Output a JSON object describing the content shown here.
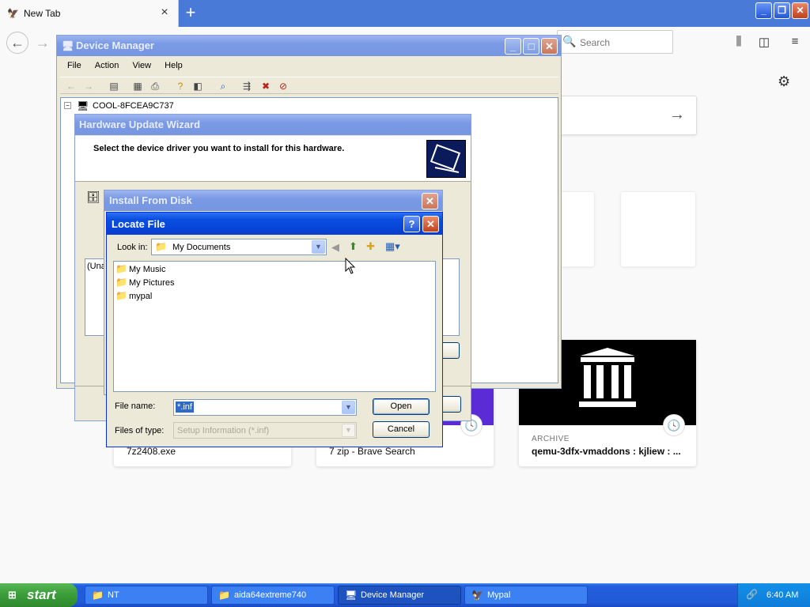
{
  "browser": {
    "tab_title": "New Tab",
    "tab_close": "×",
    "new_tab": "+",
    "search_placeholder": "Search",
    "icons": [
      "back-arrow-icon",
      "forward-arrow-icon",
      "library-icon",
      "sidebar-icon",
      "hamburger-menu-icon",
      "gear-icon",
      "search-icon"
    ],
    "cards": [
      {
        "title": "7z2408.exe"
      },
      {
        "title": "7 zip - Brave Search"
      },
      {
        "tag": "ARCHIVE",
        "title": "qemu-3dfx-vmaddons : kjliew : ..."
      }
    ]
  },
  "device_manager": {
    "title": "Device Manager",
    "menu": [
      "File",
      "Action",
      "View",
      "Help"
    ],
    "tree_root": "COOL-8FCEA9C737"
  },
  "wizard": {
    "title": "Hardware Update Wizard",
    "heading": "Select the device driver you want to install for this hardware.",
    "left_fragment": "(Una"
  },
  "install_from_disk": {
    "title": "Install From Disk"
  },
  "locate_file": {
    "title": "Locate File",
    "look_in_label": "Look in:",
    "look_in_value": "My Documents",
    "items": [
      {
        "name": "My Music",
        "icon": "music-folder-icon"
      },
      {
        "name": "My Pictures",
        "icon": "pictures-folder-icon"
      },
      {
        "name": "mypal",
        "icon": "folder-icon"
      }
    ],
    "file_name_label": "File name:",
    "file_name_value": "*.inf",
    "files_of_type_label": "Files of type:",
    "files_of_type_value": "Setup Information (*.inf)",
    "open_button": "Open",
    "cancel_button": "Cancel"
  },
  "taskbar": {
    "start": "start",
    "items": [
      {
        "label": "NT",
        "icon": "folder-icon"
      },
      {
        "label": "aida64extreme740",
        "icon": "folder-icon"
      },
      {
        "label": "Device Manager",
        "icon": "device-manager-icon"
      },
      {
        "label": "Mypal",
        "icon": "mypal-icon"
      }
    ],
    "clock": "6:40 AM"
  },
  "colors": {
    "xp_title_blue": "#0a4fe0",
    "taskbar_blue": "#245edb",
    "firefox_tabbar": "#4a7ad8",
    "start_green": "#3c9e3a"
  }
}
